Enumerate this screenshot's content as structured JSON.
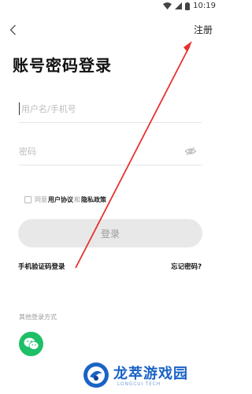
{
  "status_bar": {
    "time": "10:19"
  },
  "nav": {
    "register_label": "注册"
  },
  "title": "账号密码登录",
  "username_field": {
    "placeholder": "用户名/手机号",
    "value": ""
  },
  "password_field": {
    "placeholder": "密码",
    "value": ""
  },
  "agreement": {
    "prefix": "同意",
    "user_agreement": "用户协议",
    "conjunction": "和",
    "privacy_policy": "隐私政策",
    "checked": false
  },
  "login_button_label": "登录",
  "sms_login_label": "手机验证码登录",
  "forgot_password_label": "忘记密码?",
  "other_login_label": "其他登录方式",
  "watermark": {
    "title": "龙萃游戏园",
    "subtitle": "LONGCUI TECH"
  },
  "colors": {
    "wechat": "#1fbf67",
    "login_button_bg": "#e8e8e8",
    "annotation_arrow": "#e8322f",
    "watermark": "#1a63c6"
  },
  "icons": {
    "back": "back-arrow-icon",
    "wifi": "wifi-icon",
    "signal": "cellular-signal-icon",
    "battery": "battery-icon",
    "eye": "eye-off-icon",
    "wechat": "wechat-icon"
  }
}
